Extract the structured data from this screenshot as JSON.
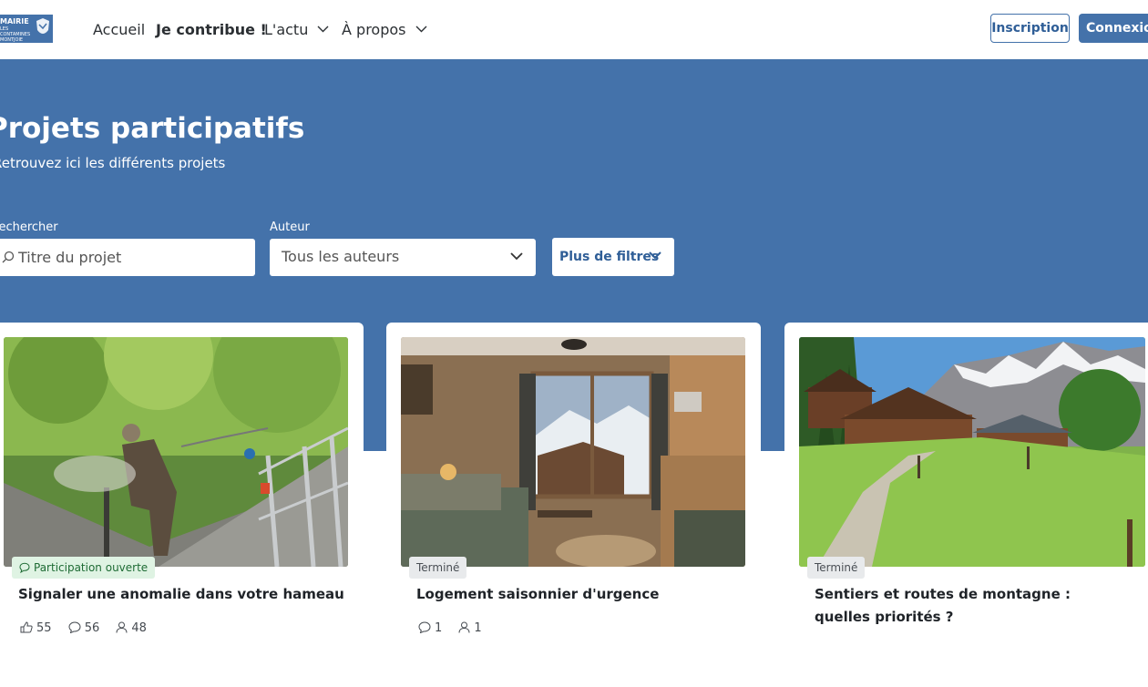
{
  "header": {
    "logo": {
      "line1": "MAIRIE",
      "line2": "LES CONTAMINES MONTJOIE"
    },
    "nav": [
      {
        "label": "Accueil"
      },
      {
        "label": "Je contribue !"
      },
      {
        "label": "L'actu"
      },
      {
        "label": "À propos"
      }
    ],
    "signup_label": "Inscription",
    "login_label": "Connexion"
  },
  "hero": {
    "title": "Projets participatifs",
    "subtitle": "Retrouvez ici les différents projets",
    "search_label": "Rechercher",
    "search_placeholder": "Titre du projet",
    "author_label": "Auteur",
    "author_value": "Tous les auteurs",
    "filters_label": "Plus de filtres"
  },
  "cards": [
    {
      "status": "Participation ouverte",
      "title": "Signaler une anomalie dans votre hameau",
      "likes": "55",
      "comments": "56",
      "participants": "48"
    },
    {
      "status": "Terminé",
      "title": "Logement saisonnier d'urgence",
      "comments": "1",
      "participants": "1"
    },
    {
      "status": "Terminé",
      "title": "Sentiers et routes de montagne : quelles priorités ?"
    }
  ],
  "colors": {
    "brand": "#4472aa",
    "open_badge_bg": "#dff3e3",
    "open_badge_text": "#1e6b34"
  }
}
